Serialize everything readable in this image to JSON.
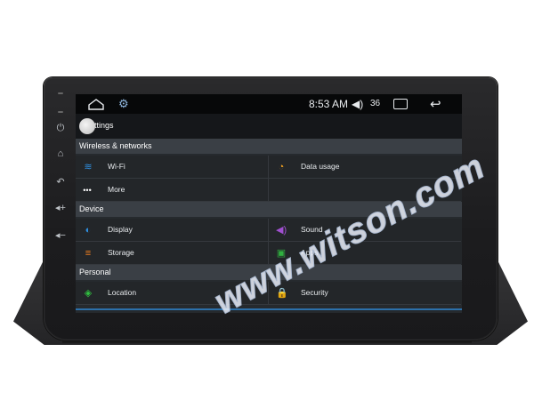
{
  "status_bar": {
    "time": "8:53 AM",
    "volume": "36",
    "colors": {
      "background": "#070809",
      "text": "#e8ebee"
    }
  },
  "title": "Settings",
  "sections": [
    {
      "label": "Wireless & networks",
      "rows": [
        [
          {
            "label": "Wi-Fi",
            "icon": "wifi-icon",
            "color": "#2f8fe0"
          },
          {
            "label": "Data usage",
            "icon": "data-usage-icon",
            "color": "#f0a020"
          }
        ],
        [
          {
            "label": "More",
            "icon": "more-dots-icon",
            "color": "#ffffff"
          },
          {
            "label": "",
            "icon": "",
            "color": ""
          }
        ]
      ]
    },
    {
      "label": "Device",
      "rows": [
        [
          {
            "label": "Display",
            "icon": "display-icon",
            "color": "#2f8fe0"
          },
          {
            "label": "Sound",
            "icon": "sound-icon",
            "color": "#a050d0"
          }
        ],
        [
          {
            "label": "Storage",
            "icon": "storage-icon",
            "color": "#f08020"
          },
          {
            "label": "Apps",
            "icon": "apps-icon",
            "color": "#30b040"
          }
        ]
      ]
    },
    {
      "label": "Personal",
      "rows": [
        [
          {
            "label": "Location",
            "icon": "location-icon",
            "color": "#30c040"
          },
          {
            "label": "Security",
            "icon": "lock-icon",
            "color": "#f0a020"
          }
        ]
      ]
    }
  ],
  "watermark": "www.witson.com"
}
